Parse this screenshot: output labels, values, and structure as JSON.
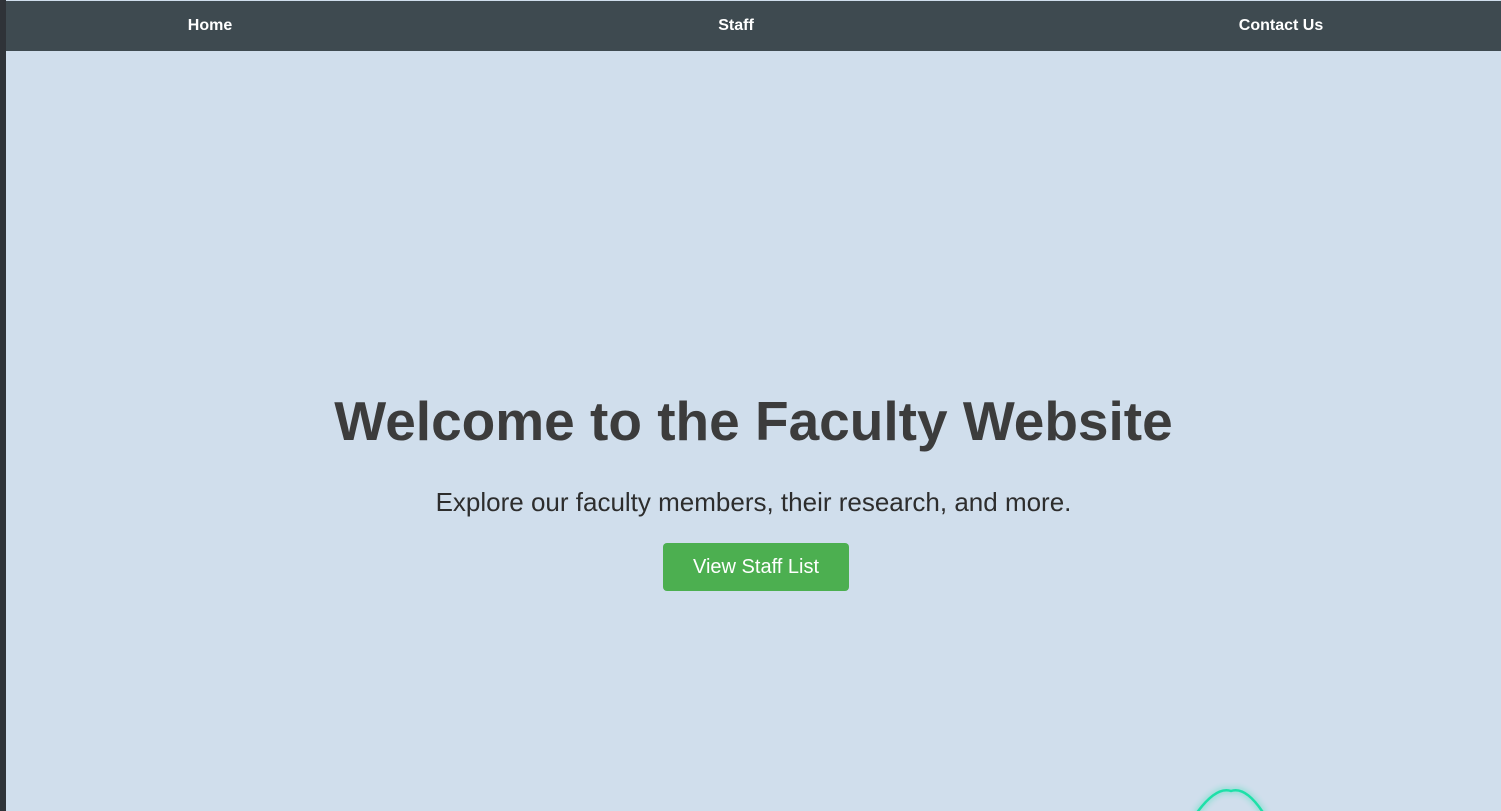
{
  "nav": {
    "home_label": "Home",
    "staff_label": "Staff",
    "contact_label": "Contact Us"
  },
  "hero": {
    "title": "Welcome to the Faculty Website",
    "subtitle": "Explore our faculty members, their research, and more.",
    "cta_label": "View Staff List"
  },
  "colors": {
    "page_background": "#d0deec",
    "navbar_background": "#3e4a50",
    "cta_background": "#4caf50",
    "widget_accent": "#1ee0a8"
  },
  "icons": {
    "bottom_widget": "wave-arc-icon"
  }
}
